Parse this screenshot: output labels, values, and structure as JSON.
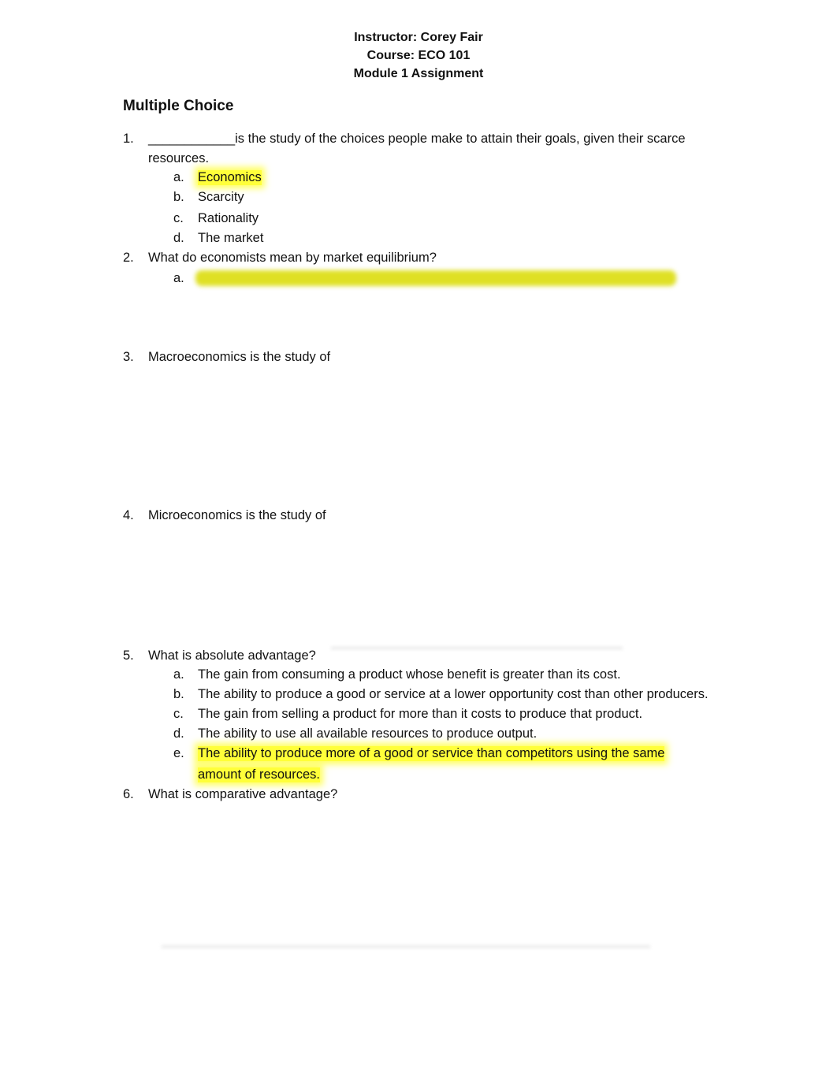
{
  "header": {
    "instructor": "Instructor: Corey Fair",
    "course": "Course: ECO 101",
    "assignment": "Module 1 Assignment"
  },
  "section_title": "Multiple Choice",
  "questions": [
    {
      "number": "1.",
      "text_line1": "____________is the study of the choices people make to attain their goals, given their scarce",
      "text_line2": "resources.",
      "options": [
        {
          "label": "a.",
          "text": "Economics",
          "highlighted": true
        },
        {
          "label": "b.",
          "text": "Scarcity",
          "highlighted": false
        },
        {
          "label": "c.",
          "text": "Rationality",
          "highlighted": false
        },
        {
          "label": "d.",
          "text": "The market",
          "highlighted": false
        }
      ]
    },
    {
      "number": "2.",
      "text": "What do economists mean by market equilibrium?",
      "options": [
        {
          "label": "a.",
          "text": "",
          "obscured": true
        }
      ]
    },
    {
      "number": "3.",
      "text": "Macroeconomics is the study of"
    },
    {
      "number": "4.",
      "text": "Microeconomics is the study of"
    },
    {
      "number": "5.",
      "text": "What is absolute advantage?",
      "options": [
        {
          "label": "a.",
          "text": "The gain from consuming a product whose benefit is greater than its cost.",
          "highlighted": false
        },
        {
          "label": "b.",
          "text": "The ability to produce a good or service at a lower opportunity cost than other producers.",
          "highlighted": false
        },
        {
          "label": "c.",
          "text": "The gain from selling a product for more than it costs to produce that product.",
          "highlighted": false
        },
        {
          "label": "d.",
          "text": "The ability to use all available resources to produce output.",
          "highlighted": false
        },
        {
          "label": "e.",
          "text_line1": "The ability to produce more of a good or service than competitors using the same",
          "text_line2": "amount of resources.",
          "highlighted": true
        }
      ]
    },
    {
      "number": "6.",
      "text": "What is comparative advantage?"
    }
  ],
  "colors": {
    "highlight": "#ffff3a",
    "text": "#111111"
  }
}
